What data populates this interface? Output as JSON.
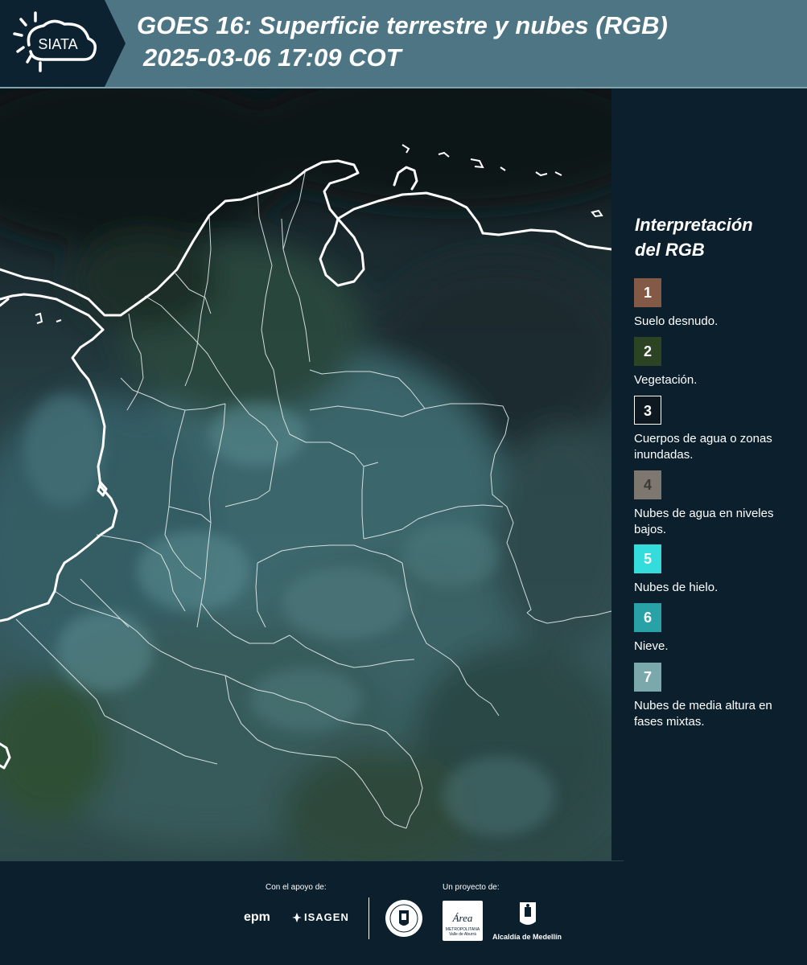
{
  "header": {
    "logo_text": "SIATA",
    "title_line1": "GOES 16: Superficie terrestre y nubes (RGB)",
    "title_line2": "2025-03-06 17:09 COT"
  },
  "map": {
    "description_icon": "satellite-rgb-map"
  },
  "legend": {
    "title_line1": "Interpretación",
    "title_line2": "del RGB",
    "items": [
      {
        "number": "1",
        "label": "Suelo desnudo.",
        "color": "#845a46"
      },
      {
        "number": "2",
        "label": "Vegetación.",
        "color": "#2d4424"
      },
      {
        "number": "3",
        "label": "Cuerpos de agua o zonas inundadas.",
        "color": "#0e1820"
      },
      {
        "number": "4",
        "label": "Nubes de agua en niveles bajos.",
        "color": "#7d776f"
      },
      {
        "number": "5",
        "label": "Nubes de hielo.",
        "color": "#35dcdc"
      },
      {
        "number": "6",
        "label": "Nieve.",
        "color": "#28a2a6"
      },
      {
        "number": "7",
        "label": "Nubes de media altura en fases mixtas.",
        "color": "#7ba8ab"
      }
    ]
  },
  "footer": {
    "support_label": "Con el apoyo de:",
    "project_label": "Un proyecto de:",
    "epm": "epm",
    "isagen": "ISAGEN",
    "area_logo": "Área",
    "area_sub": "METROPOLITANA Valle de Aburrá",
    "alcaldia": "Alcaldía de Medellín"
  }
}
